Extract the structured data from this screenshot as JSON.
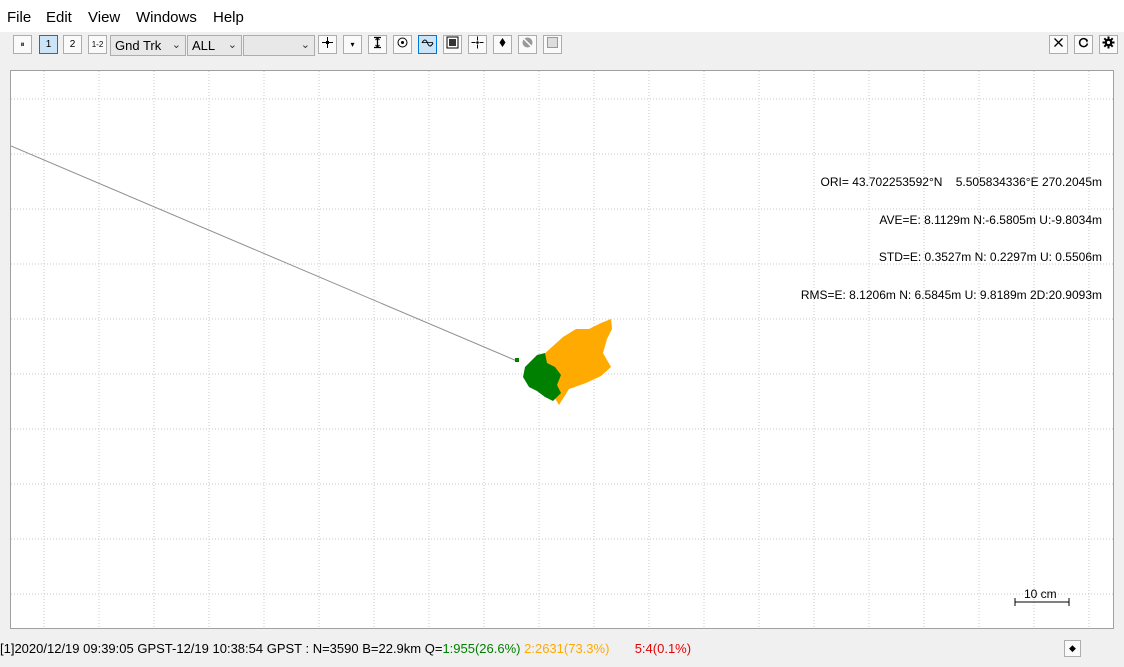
{
  "menu": {
    "file": "File",
    "edit": "Edit",
    "view": "View",
    "windows": "Windows",
    "help": "Help"
  },
  "toolbar": {
    "buttons": [
      {
        "name": "pause-icon",
        "glyph": "⏸"
      },
      {
        "name": "solution-1-button",
        "glyph": "1"
      },
      {
        "name": "solution-2-button",
        "glyph": "2"
      },
      {
        "name": "solution-1-2-button",
        "glyph": "1-2"
      }
    ],
    "plot_type": "Gnd Trk",
    "quality_filter": "ALL",
    "third_select": "",
    "right_icons": [
      "center-origin-icon",
      "dropdown-icon",
      "fit-vertical-icon",
      "center-icon",
      "time-sync-icon",
      "image-icon",
      "crosshair-icon",
      "marker-icon",
      "disabled-icon",
      "blank-icon"
    ],
    "close_icon": "close-icon",
    "reload_icon": "reload-icon",
    "settings_icon": "gear-icon"
  },
  "plot": {
    "info_lines": [
      "ORI= 43.702253592°N    5.505834336°E 270.2045m",
      "AVE=E: 8.1129m N:-6.5805m U:-9.8034m",
      "STD=E: 0.3527m N: 0.2297m U: 0.5506m",
      "RMS=E: 8.1206m N: 6.5845m U: 9.8189m 2D:20.9093m"
    ],
    "scale_label": "10 cm",
    "colors": {
      "fix": "#008000",
      "float": "#ffaa00",
      "single": "#ff0000",
      "grid": "#c8c8c8",
      "track": "#909090"
    }
  },
  "status": {
    "prefix": "[1]2020/12/19 09:39:05 GPST-12/19 10:38:54 GPST : N=3590 B=22.9km Q=",
    "q1": "1:955(26.6%)",
    "q2": "2:2631(73.3%)",
    "q5": "5:4(0.1%)",
    "colors": {
      "q1": "#008000",
      "q2": "#ffaa00",
      "q5": "#e60000"
    }
  }
}
